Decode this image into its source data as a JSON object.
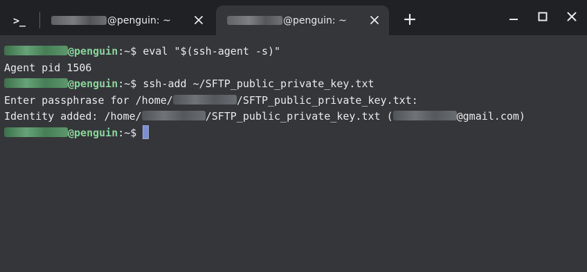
{
  "window": {
    "terminal_icon": ">_",
    "tabs": [
      {
        "title": "@penguin: ~",
        "active": false
      },
      {
        "title": "@penguin: ~",
        "active": true
      }
    ],
    "new_tab_icon": "plus-icon",
    "controls": [
      "minimize-icon",
      "maximize-icon",
      "close-icon"
    ]
  },
  "terminal": {
    "prompt_host": "@penguin",
    "prompt_path": ":~$ ",
    "lines": [
      {
        "type": "prompt",
        "command": "eval \"$(ssh-agent -s)\""
      },
      {
        "type": "output",
        "text": "Agent pid 1506"
      },
      {
        "type": "prompt",
        "command": "ssh-add ~/SFTP_public_private_key.txt"
      },
      {
        "type": "output_redacted",
        "before": "Enter passphrase for /home/",
        "after": "/SFTP_public_private_key.txt:"
      },
      {
        "type": "output_redacted2",
        "before": "Identity added: /home/",
        "middle": "/SFTP_public_private_key.txt (",
        "after": "@gmail.com)"
      },
      {
        "type": "prompt_cursor"
      }
    ]
  },
  "colors": {
    "background": "#202124",
    "terminal_bg": "#35363a",
    "prompt_user": "#8ad49b",
    "text": "#e8eaed",
    "cursor": "#7b8fd1"
  }
}
